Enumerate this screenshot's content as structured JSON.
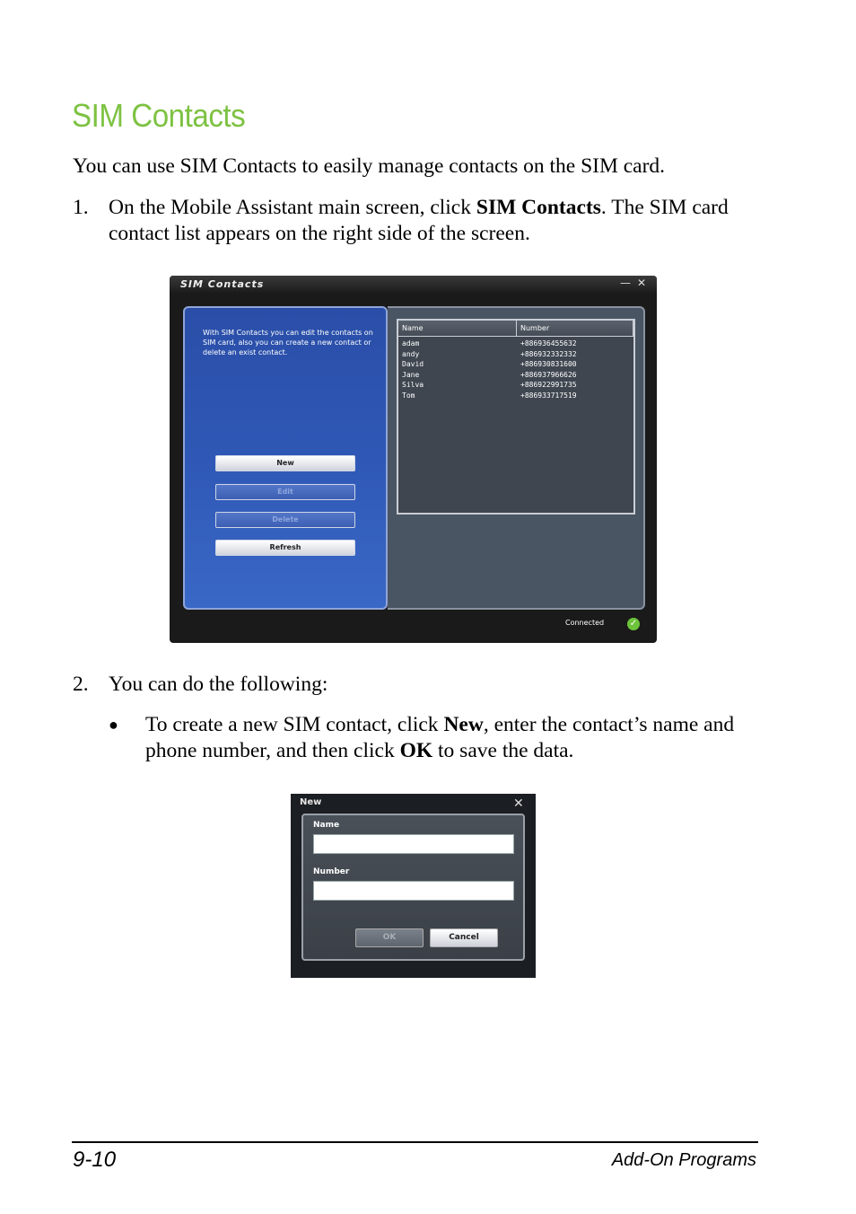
{
  "heading": "SIM Contacts",
  "intro": "You can use SIM Contacts to easily manage contacts on the SIM card.",
  "step1": {
    "number": "1.",
    "text_before": "On the Mobile Assistant main screen, click ",
    "bold": "SIM Contacts",
    "text_after": ". The SIM card contact list appears on the right side of the screen."
  },
  "sim_window": {
    "title": "SIM Contacts",
    "minimize_glyph": "—",
    "close_glyph": "✕",
    "description": "With SIM Contacts you can edit the contacts on SIM card, also you can create a new contact or delete an exist contact.",
    "buttons": [
      {
        "label": "New",
        "enabled": true
      },
      {
        "label": "Edit",
        "enabled": false
      },
      {
        "label": "Delete",
        "enabled": false
      },
      {
        "label": "Refresh",
        "enabled": true
      }
    ],
    "columns": [
      "Name",
      "Number"
    ],
    "contacts": [
      {
        "name": "adam",
        "number": "+886936455632"
      },
      {
        "name": "andy",
        "number": "+886932332332"
      },
      {
        "name": "David",
        "number": "+886930831600"
      },
      {
        "name": "Jane",
        "number": "+886937966626"
      },
      {
        "name": "Silva",
        "number": "+886922991735"
      },
      {
        "name": "Tom",
        "number": "+886933717519"
      }
    ],
    "status": "Connected",
    "status_icon": "check-icon"
  },
  "step2": {
    "number": "2.",
    "text": "You can do the following:"
  },
  "bullet1": {
    "glyph": "●",
    "t1": "To create a new SIM contact, click ",
    "b1": "New",
    "t2": ", enter the contact’s name and phone number, and then click ",
    "b2": "OK",
    "t3": " to save the data."
  },
  "new_dialog": {
    "title": "New",
    "close_glyph": "✕",
    "name_label": "Name",
    "number_label": "Number",
    "name_value": "",
    "number_value": "",
    "ok_label": "OK",
    "cancel_label": "Cancel"
  },
  "footer": {
    "page_number": "9-10",
    "section": "Add-On Programs"
  }
}
